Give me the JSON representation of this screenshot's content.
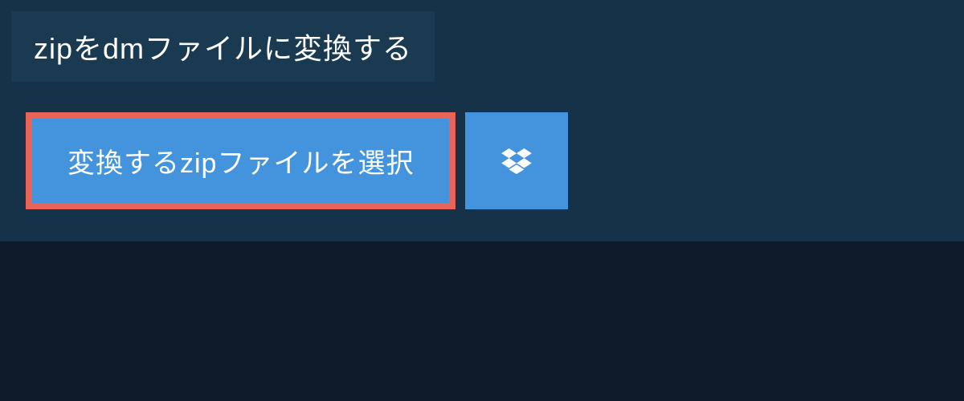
{
  "title": "zipをdmファイルに変換する",
  "buttons": {
    "select_file_label": "変換するzipファイルを選択"
  },
  "colors": {
    "background": "#0d1b2a",
    "panel": "#163248",
    "title_bar": "#1a3a52",
    "button_primary": "#4394dc",
    "button_border": "#e86458",
    "text": "#ffffff"
  }
}
